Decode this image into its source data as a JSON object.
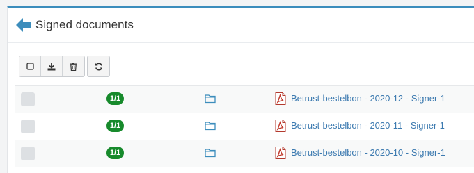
{
  "header": {
    "title": "Signed documents"
  },
  "toolbar": {
    "buttons": [
      {
        "name": "select-all-checkbox",
        "icon": "checkbox-icon"
      },
      {
        "name": "download-button",
        "icon": "download-icon"
      },
      {
        "name": "delete-button",
        "icon": "trash-icon"
      }
    ],
    "refresh_icon": "refresh-icon"
  },
  "documents": [
    {
      "status": "1/1",
      "name": "Betrust-bestelbon - 2020-12 - Signer-1"
    },
    {
      "status": "1/1",
      "name": "Betrust-bestelbon - 2020-11 - Signer-1"
    },
    {
      "status": "1/1",
      "name": "Betrust-bestelbon - 2020-10 - Signer-1"
    }
  ],
  "colors": {
    "accent": "#3c8dbc",
    "badge": "#178a2c",
    "link": "#3c7ab0",
    "pdf": "#c0392b"
  }
}
